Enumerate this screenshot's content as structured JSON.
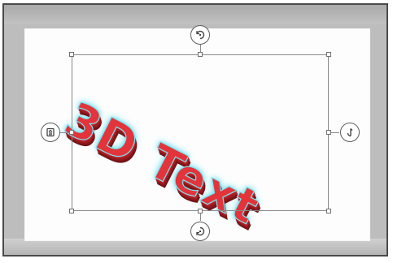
{
  "wordart": {
    "text": "3D Text",
    "fill_color": "#e2343a",
    "extrusion_color": "#8c171b",
    "glow_color": "#7ee3f0"
  },
  "controls": {
    "top": {
      "icon": "rotate-x-icon"
    },
    "bottom": {
      "icon": "rotate-x-reverse-icon"
    },
    "left": {
      "icon": "rotate-z-icon"
    },
    "right": {
      "icon": "rotate-y-icon"
    }
  },
  "colors": {
    "frame_border": "#4a4a4a",
    "frame_fill": "#bdbdbd",
    "canvas": "#fdfdfd",
    "selection_border": "#8a8a8a"
  }
}
